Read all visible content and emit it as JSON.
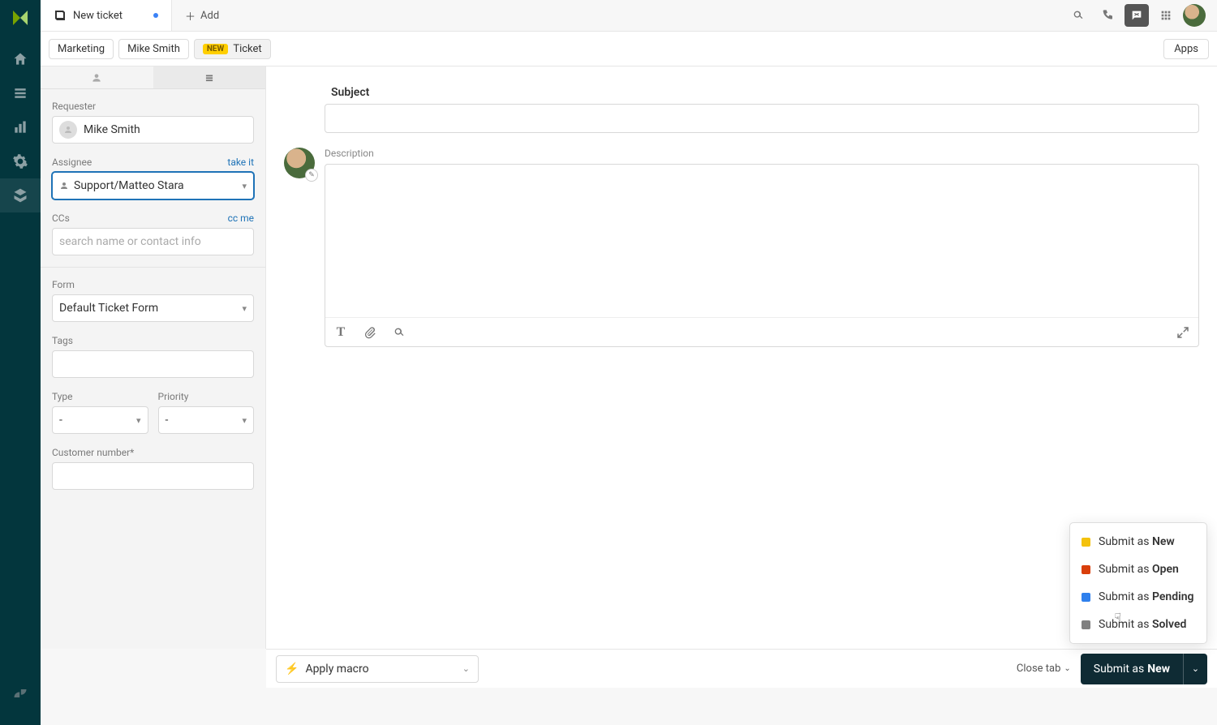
{
  "nav": {
    "items": [
      "home",
      "views",
      "reporting",
      "admin",
      "apps"
    ]
  },
  "topbar": {
    "tab_label": "New ticket",
    "add_label": "Add"
  },
  "crumbs": {
    "org": "Marketing",
    "user": "Mike Smith",
    "badge": "NEW",
    "kind": "Ticket",
    "apps_btn": "Apps"
  },
  "fields": {
    "requester_label": "Requester",
    "requester_value": "Mike Smith",
    "assignee_label": "Assignee",
    "assignee_link": "take it",
    "assignee_value": "Support/Matteo Stara",
    "ccs_label": "CCs",
    "ccs_link": "cc me",
    "ccs_placeholder": "search name or contact info",
    "form_label": "Form",
    "form_value": "Default Ticket Form",
    "tags_label": "Tags",
    "type_label": "Type",
    "type_value": "-",
    "priority_label": "Priority",
    "priority_value": "-",
    "customer_label": "Customer number*"
  },
  "main": {
    "subject_label": "Subject",
    "description_label": "Description"
  },
  "footer": {
    "macro_label": "Apply macro",
    "close_label": "Close tab",
    "submit_prefix": "Submit as ",
    "submit_status": "New"
  },
  "menu": {
    "prefix": "Submit as ",
    "items": [
      {
        "status": "New",
        "color": "#f4c20d"
      },
      {
        "status": "Open",
        "color": "#d93f0b"
      },
      {
        "status": "Pending",
        "color": "#2f80ed"
      },
      {
        "status": "Solved",
        "color": "#808080"
      }
    ]
  }
}
